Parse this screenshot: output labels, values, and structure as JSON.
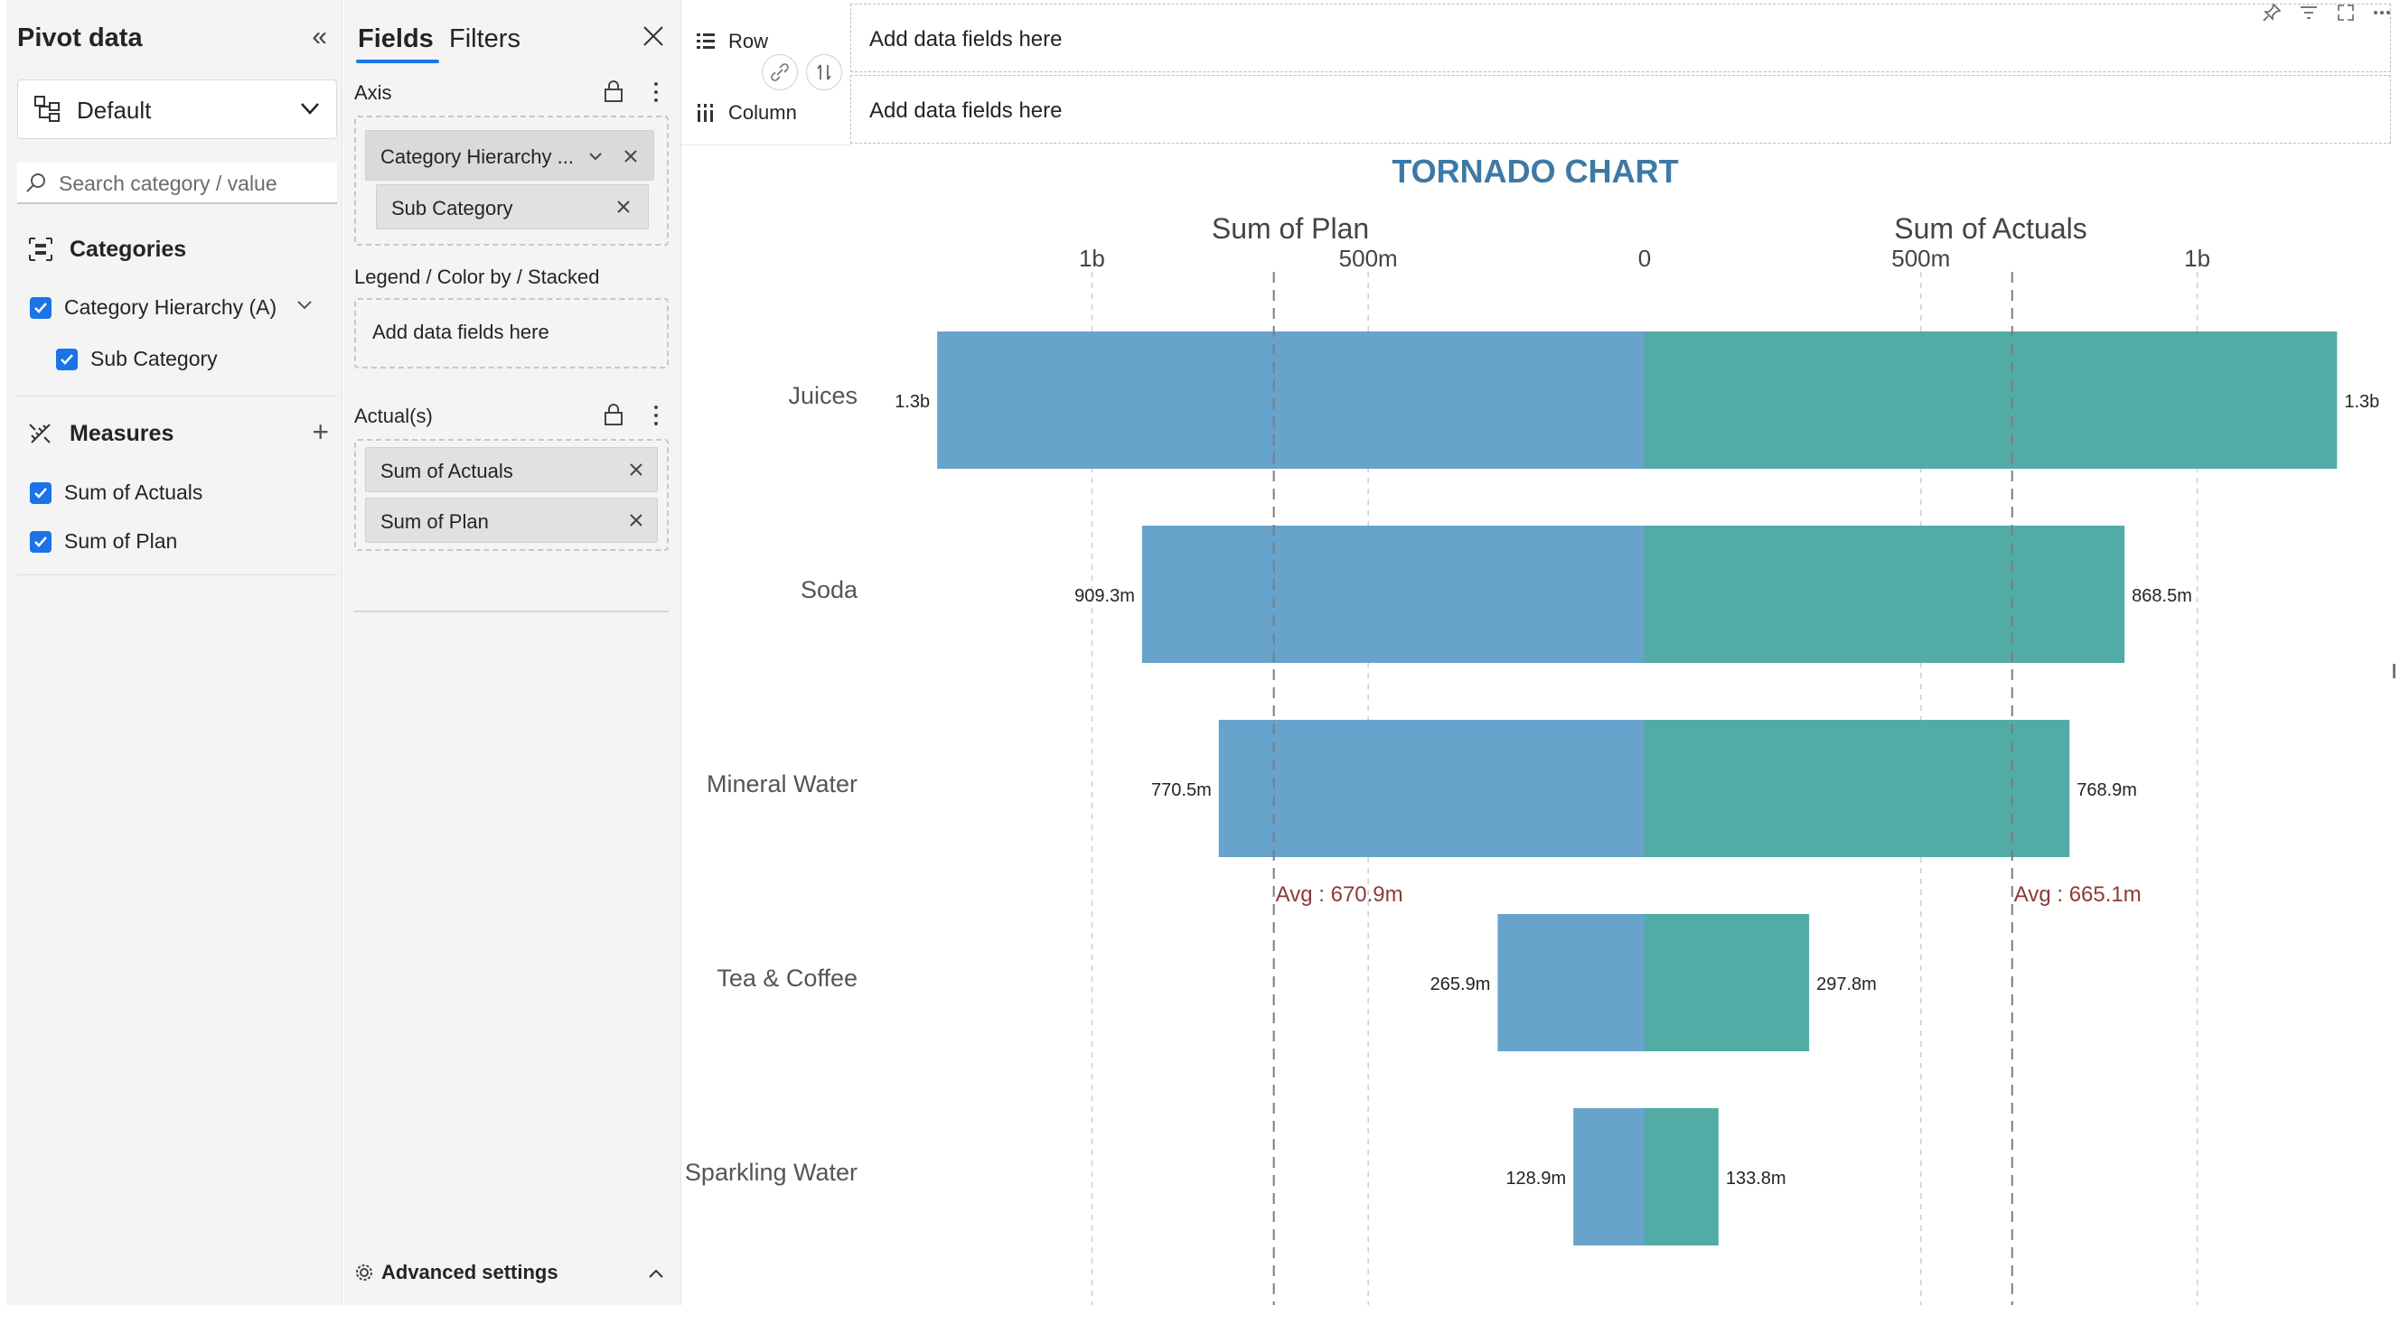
{
  "pivot": {
    "title": "Pivot data",
    "view_selected": "Default",
    "search_placeholder": "Search category / value",
    "categories_label": "Categories",
    "categories": [
      {
        "label": "Category Hierarchy (A)",
        "checked": true
      },
      {
        "label": "Sub Category",
        "checked": true
      }
    ],
    "measures_label": "Measures",
    "measures": [
      {
        "label": "Sum of Actuals",
        "checked": true
      },
      {
        "label": "Sum of Plan",
        "checked": true
      }
    ]
  },
  "fields": {
    "tab_fields": "Fields",
    "tab_filters": "Filters",
    "axis_label": "Axis",
    "axis_chips": [
      "Category Hierarchy ...",
      "Sub Category"
    ],
    "legend_label": "Legend / Color by / Stacked",
    "legend_placeholder": "Add data fields here",
    "actuals_label": "Actual(s)",
    "actual_chips": [
      "Sum of Actuals",
      "Sum of Plan"
    ],
    "advanced_label": "Advanced settings"
  },
  "shelves": {
    "row_label": "Row",
    "column_label": "Column",
    "row_placeholder": "Add data fields here",
    "column_placeholder": "Add data fields here"
  },
  "colors": {
    "plan": "#67a3cb",
    "actuals": "#52aca5",
    "title": "#3d79a6",
    "avg_text": "#8b3a3a",
    "accent": "#1a73e8"
  },
  "chart_data": {
    "type": "bar",
    "orientation": "horizontal-tornado",
    "title": "TORNADO CHART",
    "left_series_title": "Sum of Plan",
    "right_series_title": "Sum of Actuals",
    "categories": [
      "Juices",
      "Soda",
      "Mineral Water",
      "Tea & Coffee",
      "Sparkling Water"
    ],
    "series": [
      {
        "name": "Sum of Plan",
        "side": "left",
        "values": [
          1280,
          909.3,
          770.5,
          265.9,
          128.9
        ],
        "labels": [
          "1.3b",
          "909.3m",
          "770.5m",
          "265.9m",
          "128.9m"
        ]
      },
      {
        "name": "Sum of Actuals",
        "side": "right",
        "values": [
          1253,
          868.5,
          768.9,
          297.8,
          133.8
        ],
        "labels": [
          "1.3b",
          "868.5m",
          "768.9m",
          "297.8m",
          "133.8m"
        ]
      }
    ],
    "value_unit": "millions",
    "xlim": [
      -1280,
      1253
    ],
    "ticks": [
      {
        "value": -1000,
        "label": "1b"
      },
      {
        "value": -500,
        "label": "500m"
      },
      {
        "value": 0,
        "label": "0"
      },
      {
        "value": 500,
        "label": "500m"
      },
      {
        "value": 1000,
        "label": "1b"
      }
    ],
    "averages": [
      {
        "side": "left",
        "value": 670.9,
        "label": "Avg : 670.9m"
      },
      {
        "side": "right",
        "value": 665.1,
        "label": "Avg : 665.1m"
      }
    ],
    "grid": true
  }
}
